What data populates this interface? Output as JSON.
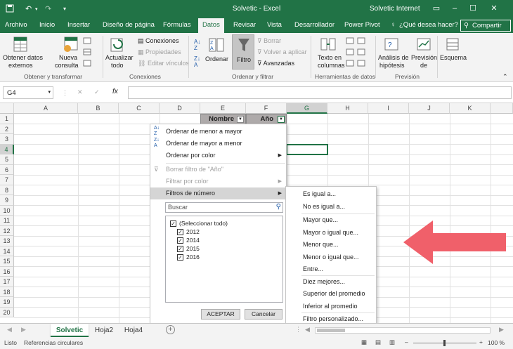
{
  "window": {
    "title": "Solvetic - Excel",
    "user": "Solvetic Internet"
  },
  "tabs": [
    "Archivo",
    "Inicio",
    "Insertar",
    "Diseño de página",
    "Fórmulas",
    "Datos",
    "Revisar",
    "Vista",
    "Desarrollador",
    "Power Pivot"
  ],
  "active_tab": "Datos",
  "tell_me": "¿Qué desea hacer?",
  "share_label": "Compartir",
  "ribbon": {
    "get_data_l1": "Obtener datos",
    "get_data_l2": "externos",
    "new_query_l1": "Nueva",
    "new_query_l2": "consulta",
    "group1": "Obtener y transformar",
    "refresh_l1": "Actualizar",
    "refresh_l2": "todo",
    "connections": "Conexiones",
    "properties": "Propiedades",
    "edit_links": "Editar vínculos",
    "group2": "Conexiones",
    "sort": "Ordenar",
    "filter": "Filtro",
    "clear": "Borrar",
    "reapply": "Volver a aplicar",
    "advanced": "Avanzadas",
    "group3": "Ordenar y filtrar",
    "text_to_cols_l1": "Texto en",
    "text_to_cols_l2": "columnas",
    "group4": "Herramientas de datos",
    "whatif_l1": "Análisis de",
    "whatif_l2": "hipótesis",
    "forecast_l1": "Previsión",
    "forecast_l2": "de",
    "group5": "Previsión",
    "outline": "Esquema"
  },
  "formula_bar": {
    "name_box": "G4",
    "fx": "fx",
    "formula": ""
  },
  "columns": [
    "A",
    "B",
    "C",
    "D",
    "E",
    "F",
    "G",
    "H",
    "I",
    "J",
    "K"
  ],
  "rows": [
    "1",
    "2",
    "3",
    "4",
    "5",
    "6",
    "7",
    "8",
    "9",
    "10",
    "11",
    "12",
    "13",
    "14",
    "15",
    "16",
    "17",
    "18",
    "19",
    "20"
  ],
  "cells": {
    "e1": "Nombre",
    "f1": "Año"
  },
  "dropdown": {
    "sort_asc": "Ordenar de menor a mayor",
    "sort_desc": "Ordenar de mayor a menor",
    "sort_color": "Ordenar por color",
    "clear_filter": "Borrar filtro de \"Año\"",
    "filter_color": "Filtrar por color",
    "number_filters": "Filtros de número",
    "search_placeholder": "Buscar",
    "items": [
      "(Seleccionar todo)",
      "2012",
      "2014",
      "2015",
      "2016"
    ],
    "ok": "ACEPTAR",
    "cancel": "Cancelar"
  },
  "submenu": [
    "Es igual a...",
    "No es igual a...",
    "Mayor que...",
    "Mayor o igual que...",
    "Menor que...",
    "Menor o igual que...",
    "Entre...",
    "Diez mejores...",
    "Superior del promedio",
    "Inferior al promedio",
    "Filtro personalizado..."
  ],
  "sheets": [
    "Solvetic",
    "Hoja2",
    "Hoja4"
  ],
  "active_sheet": "Solvetic",
  "status": {
    "ready": "Listo",
    "circular": "Referencias circulares",
    "zoom": "100 %"
  },
  "colors": {
    "excel_green": "#217346",
    "arrow": "#f0606a"
  }
}
